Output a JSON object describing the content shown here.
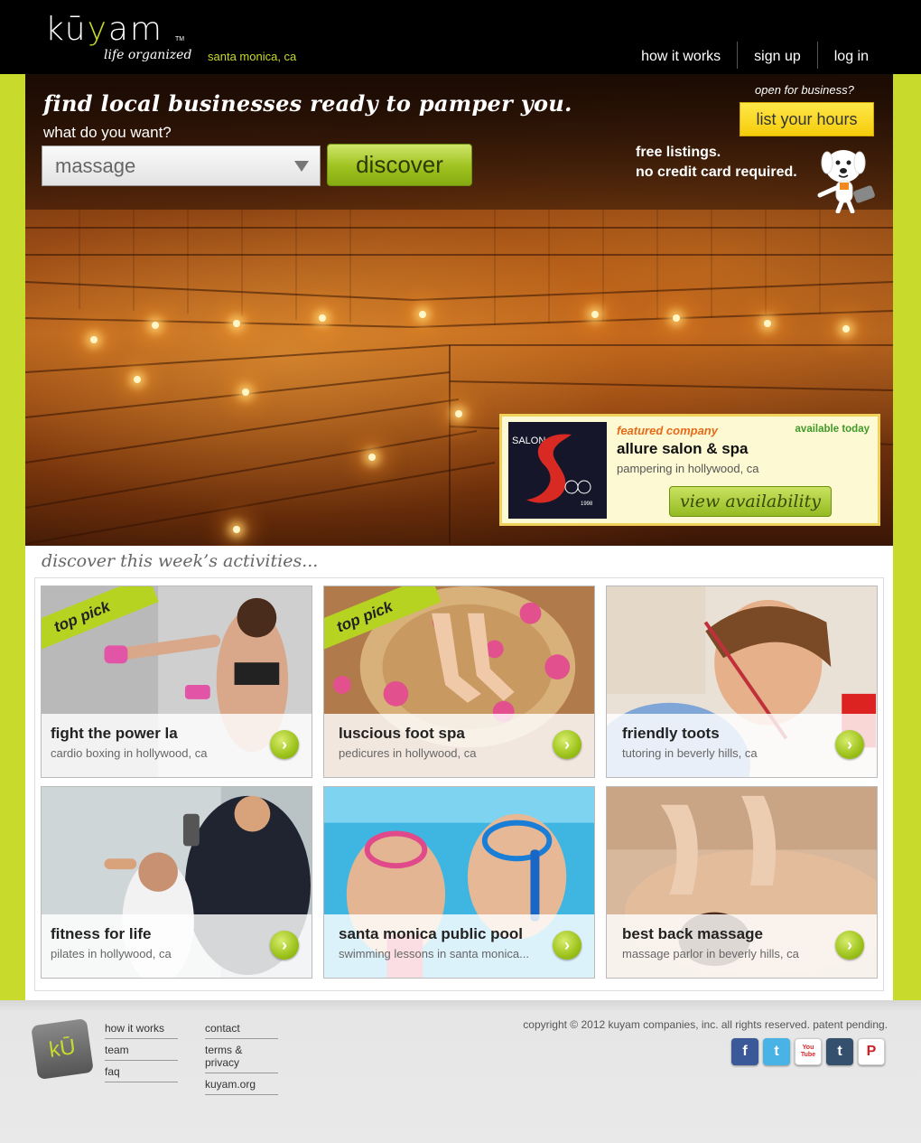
{
  "header": {
    "logo_word_a": "kū",
    "logo_word_y": "y",
    "logo_word_b": "am",
    "logo_tm": "TM",
    "tagline": "life organized",
    "location": "santa monica, ca",
    "nav": [
      "how it works",
      "sign up",
      "log in"
    ]
  },
  "hero": {
    "headline": "find local businesses ready to pamper you.",
    "question": "what do you want?",
    "search_value": "massage",
    "discover_label": "discover",
    "open_for_business": "open for business?",
    "list_hours_label": "list your hours",
    "free_line1": "free listings.",
    "free_line2": "no credit card required."
  },
  "featured": {
    "label": "featured company",
    "availability": "available today",
    "name": "allure salon & spa",
    "description": "pampering in hollywood, ca",
    "logo_text": "SALON",
    "logo_year": "1998",
    "button": "view availability"
  },
  "activities": {
    "title": "discover this week’s activities...",
    "ribbon_label": "top pick",
    "cards": [
      {
        "title": "fight the power la",
        "subtitle": "cardio boxing in hollywood, ca",
        "top_pick": true
      },
      {
        "title": "luscious foot spa",
        "subtitle": "pedicures in hollywood, ca",
        "top_pick": true
      },
      {
        "title": "friendly toots",
        "subtitle": "tutoring in beverly hills, ca",
        "top_pick": false
      },
      {
        "title": "fitness for life",
        "subtitle": "pilates in hollywood, ca",
        "top_pick": false
      },
      {
        "title": "santa monica public pool",
        "subtitle": "swimming lessons in santa monica...",
        "top_pick": false
      },
      {
        "title": "best back massage",
        "subtitle": "massage parlor in beverly hills, ca",
        "top_pick": false
      }
    ]
  },
  "footer": {
    "logo_text": "kŪ",
    "col1": [
      "how it works",
      "team",
      "faq"
    ],
    "col2": [
      "contact",
      "terms & privacy",
      "kuyam.org"
    ],
    "copyright": "copyright © 2012 kuyam companies, inc. all rights reserved. patent pending.",
    "social": [
      {
        "icon": "facebook-icon",
        "glyph": "f",
        "color": "#3b5998"
      },
      {
        "icon": "twitter-icon",
        "glyph": "t",
        "color": "#4ab3e6"
      },
      {
        "icon": "youtube-icon",
        "glyph": "You Tube",
        "color": "#d22"
      },
      {
        "icon": "tumblr-icon",
        "glyph": "t",
        "color": "#35506c"
      },
      {
        "icon": "pinterest-icon",
        "glyph": "P",
        "color": "#cb2027"
      }
    ]
  },
  "colors": {
    "brand_green": "#c8da2b",
    "featured_orange": "#e56a1a",
    "available_green": "#3f9a2a"
  }
}
